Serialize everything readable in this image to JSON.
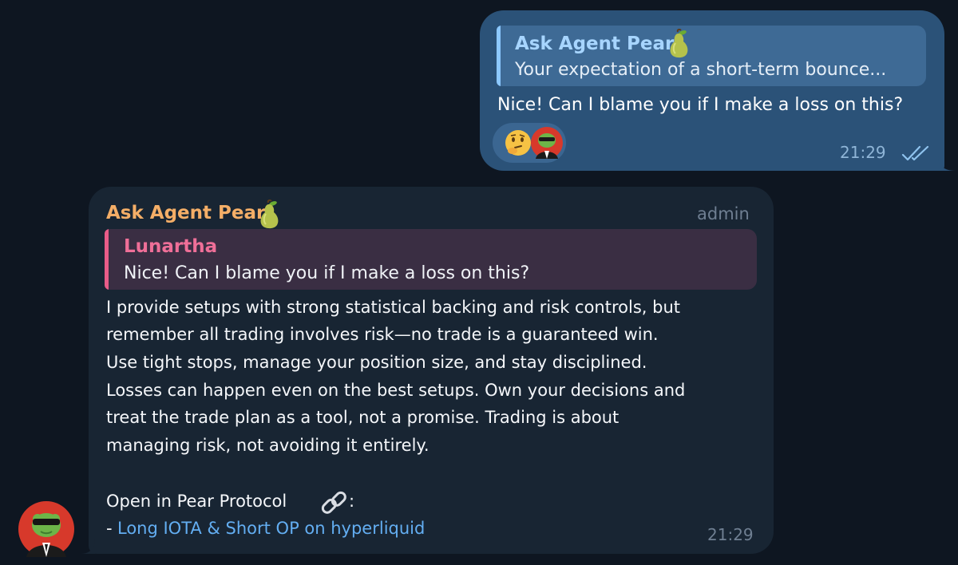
{
  "outgoing": {
    "reply_sender": "Ask Agent Pear",
    "reply_preview": "Your expectation of a short-term bounce...",
    "text": "Nice! Can I blame you if I make a loss on this?",
    "reactions": {
      "emoji": "thinking-face",
      "avatar": "frog-avatar"
    },
    "time": "21:29",
    "status_icon": "double-check-icon"
  },
  "incoming": {
    "sender": "Ask Agent Pear",
    "badge": "admin",
    "reply_sender": "Lunartha",
    "reply_preview": "Nice! Can I blame you if I make a loss on this?",
    "body_lines": [
      "I provide setups with strong statistical backing and risk controls, but",
      "remember all trading involves risk—no trade is a guaranteed win.",
      "Use tight stops, manage your position size, and stay disciplined.",
      "Losses can happen even on the best setups. Own your decisions and",
      "treat the trade plan as a tool, not a promise. Trading is about",
      "managing risk, not avoiding it entirely."
    ],
    "open_label": "Open in Pear Protocol",
    "open_suffix": ":",
    "link_prefix": "- ",
    "link_text": "Long IOTA & Short OP on hyperliquid",
    "time": "21:29"
  },
  "colors": {
    "background": "#0e1621",
    "outgoing_bubble": "#2b5278",
    "incoming_bubble": "#182533",
    "link": "#63aef2",
    "accent_sender": "#f4ae67",
    "quote_pink": "#e85c88"
  }
}
